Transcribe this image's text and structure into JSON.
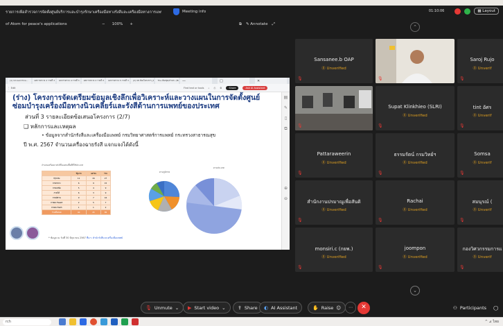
{
  "window": {
    "doc_title": "รายการเพื่อสำรวจการจัดตั้งศูนย์บริการและบำรุงรักษาเครื่องมือทางรังสีและเครื่องมือทางการแพทย์ของประเทศ...",
    "meeting_info_label": "Meeting info",
    "time": "01:10:06",
    "layout_label": "Layout"
  },
  "share_bar": {
    "title": "of Atom for peace's applications",
    "zoom_minus": "−",
    "zoom_value": "100%",
    "zoom_plus": "+",
    "annotate_label": "Annotate"
  },
  "slide": {
    "browser_tabs": [
      "(1) Unread Ema...",
      "ผลการตรวจ 2 รายที่ 3 -",
      "ผลการตรวจ 4 รายที่ 3 -",
      "ผลการตรวจ 4 รายที่ 3 -",
      "ผลการตรวจ 5 รายที่ 3 -",
      "(2) 08 ห้องโครงการ_0_final",
      "The ห้องชุด/ส่วนก. (Map)"
    ],
    "tools_left": "⋮ Edit",
    "find_label": "Find text or tools",
    "share_btn": "Share",
    "ai_btn": "Ask AI Assistant",
    "title_line1": "(ร่าง) โครงการจัดเตรียมข้อมูลเชิงลึกเพื่อวิเคราะห์และวางแผนในการจัดตั้งศูนย์",
    "title_line2": "ซ่อมบำรุงเครื่องมือทางนิวเคลียร์และรังสีด้านการแพทย์ของประเทศ",
    "section": "ส่วนที่ 3 รายละเอียดข้อเสนอโครงการ (2/7)",
    "bullet1": "❑  หลักการและเหตุผล",
    "bullet2": "•  ข้อมูลจากสำนักรังสีและเครื่องมือแพทย์ กรมวิทยาศาสตร์การแพทย์ กระทรวงสาธารณสุข",
    "bullet3": "ปี พ.ศ. 2567 จำนวนเครื่องฉายรังสี แจกแจงได้ดังนี้",
    "table_caption": "จำนวนเครื่องฉายรังสีในแต่ละพื้นที่ที่ใช้ประเภท",
    "table_head": [
      "",
      "รัฐบาล",
      "เอกชน",
      "รวม"
    ],
    "table_rows": [
      [
        "กรุงเทพ",
        "11",
        "16",
        "27"
      ],
      [
        "ภาคกลาง",
        "6",
        "9",
        "15"
      ],
      [
        "ภาคเหนือ",
        "5",
        "4",
        "9"
      ],
      [
        "ภาคใต้",
        "6",
        "3",
        "9"
      ],
      [
        "ภาคอีสาน",
        "9",
        "7",
        "16"
      ],
      [
        "ภาคตะวันออก",
        "2",
        "5",
        "7"
      ],
      [
        "ภาคตะวันตก",
        "1",
        "1",
        "2"
      ]
    ],
    "table_total": [
      "รวมทั้งหมด",
      "40",
      "45",
      "85"
    ],
    "pie1_caption": "ตามภูมิภาค",
    "pie2_caption": "ตามประเภท",
    "footnote": "* ข้อมูล ณ วันที่ 30 มิถุนายน 2567",
    "footnote_link": "ที่มา: สำนักรังสีและเครื่องมือแพทย์"
  },
  "tiles": [
    {
      "name": "Sansanee.b OAP",
      "status": "Unverified",
      "cam": false
    },
    {
      "name": "",
      "status": "",
      "cam": true
    },
    {
      "name": "Saroj Rujo",
      "status": "Unverif",
      "cam": false
    },
    {
      "name": "",
      "status": "",
      "cam": true
    },
    {
      "name": "Supat Klinkhieo (SLRI)",
      "status": "Unverified",
      "cam": false
    },
    {
      "name": "tint อัศร",
      "status": "Unverif",
      "cam": false
    },
    {
      "name": "Pattaraweerin",
      "status": "Unverified",
      "cam": false
    },
    {
      "name": "ธรรมรัตน์ กรมวิทย์ฯ",
      "status": "Unverified",
      "cam": false
    },
    {
      "name": "Somsa",
      "status": "Unverif",
      "cam": false
    },
    {
      "name": "สำนักงานปรมาณูเพื่อสันติ",
      "status": "Unverified",
      "cam": false
    },
    {
      "name": "Rachai",
      "status": "Unverified",
      "cam": false
    },
    {
      "name": "สมนุรณ์ (",
      "status": "Unverif",
      "cam": false
    },
    {
      "name": "monsiri.c (กยพ.)",
      "status": "Unverified",
      "cam": false
    },
    {
      "name": "joompon",
      "status": "Unverified",
      "cam": false
    },
    {
      "name": "กองวิศวกรรมการแ",
      "status": "Unverif",
      "cam": false
    }
  ],
  "controls": {
    "unmute": "Unmute",
    "start_video": "Start video",
    "share": "Share",
    "ai_assistant": "AI Assistant",
    "raise": "Raise",
    "participants": "Participants"
  },
  "taskbar": {
    "search": "rch",
    "tray": "^  ⊿  ไทย"
  },
  "colors": {
    "meeting_bg": "#1c1c1c",
    "tile_bg": "#2b2b2b",
    "unverified": "#e0a020",
    "end_red": "#e53935",
    "slide_title_blue": "#1a3a80"
  }
}
